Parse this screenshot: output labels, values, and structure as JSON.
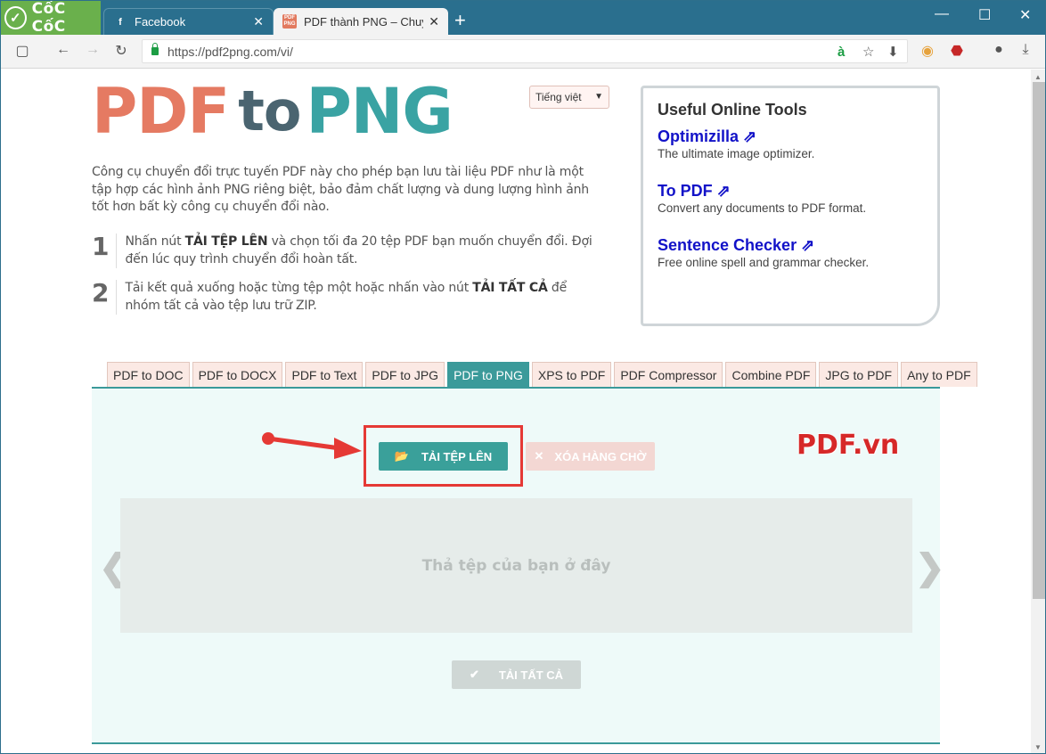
{
  "browser": {
    "brand": "CốC CốC",
    "tabs": [
      {
        "title": "Facebook",
        "favicon": "facebook-icon",
        "active": false
      },
      {
        "title": "PDF thành PNG – Chuyển",
        "favicon": "pdf2png-icon",
        "active": true
      }
    ],
    "url": "https://pdf2png.com/vi/",
    "colors": {
      "tabbar": "#2a6f8e",
      "brand": "#6ab04c"
    }
  },
  "page": {
    "logo": {
      "part1": "PDF",
      "part2": "to",
      "part3": "PNG"
    },
    "language": "Tiếng việt",
    "intro": "Công cụ chuyển đổi trực tuyến PDF này cho phép bạn lưu tài liệu PDF như là một tập hợp các hình ảnh PNG riêng biệt, bảo đảm chất lượng và dung lượng hình ảnh tốt hơn bất kỳ công cụ chuyển đổi nào.",
    "steps": [
      {
        "num": "1",
        "before": "Nhấn nút ",
        "bold": "TẢI TỆP LÊN",
        "after": " và chọn tối đa 20 tệp PDF bạn muốn chuyển đổi. Đợi đến lúc quy trình chuyển đổi hoàn tất."
      },
      {
        "num": "2",
        "before": "Tải kết quả xuống hoặc từng tệp một hoặc nhấn vào nút ",
        "bold": "TẢI TẤT CẢ",
        "after": " để nhóm tất cả vào tệp lưu trữ ZIP."
      }
    ],
    "tools": {
      "title": "Useful Online Tools",
      "items": [
        {
          "name": "Optimizilla ⇗",
          "desc": "The ultimate image optimizer."
        },
        {
          "name": "To PDF ⇗",
          "desc": "Convert any documents to PDF format."
        },
        {
          "name": "Sentence Checker ⇗",
          "desc": "Free online spell and grammar checker."
        }
      ]
    },
    "nav_tabs": [
      "PDF to DOC",
      "PDF to DOCX",
      "PDF to Text",
      "PDF to JPG",
      "PDF to PNG",
      "XPS to PDF",
      "PDF Compressor",
      "Combine PDF",
      "JPG to PDF",
      "Any to PDF"
    ],
    "active_tab": "PDF to PNG",
    "upload_button": "TẢI TỆP LÊN",
    "clear_button": "XÓA HÀNG CHỜ",
    "dropzone_text": "Thả tệp của bạn ở đây",
    "download_all_button": "TẢI TẤT CẢ",
    "watermark": "PDF.vn",
    "colors": {
      "accent": "#3aa09a",
      "highlight": "#e53935",
      "pdf_color": "#e57a62",
      "png_color": "#3aa3a3"
    }
  }
}
